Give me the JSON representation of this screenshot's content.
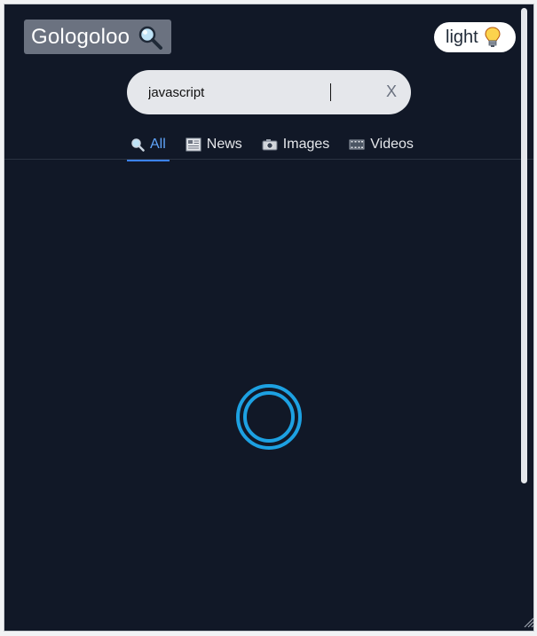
{
  "header": {
    "logo_text": "Gologoloo",
    "logo_icon": "magnifier-icon",
    "theme_label": "light",
    "theme_icon": "lightbulb-icon"
  },
  "search": {
    "value": "javascript",
    "clear_label": "X"
  },
  "tabs": [
    {
      "label": "All",
      "icon": "search-icon",
      "active": true
    },
    {
      "label": "News",
      "icon": "newspaper-icon",
      "active": false
    },
    {
      "label": "Images",
      "icon": "camera-icon",
      "active": false
    },
    {
      "label": "Videos",
      "icon": "film-icon",
      "active": false
    }
  ],
  "colors": {
    "background": "#111827",
    "accent": "#3b82f6",
    "spinner": "#1da1e2"
  }
}
